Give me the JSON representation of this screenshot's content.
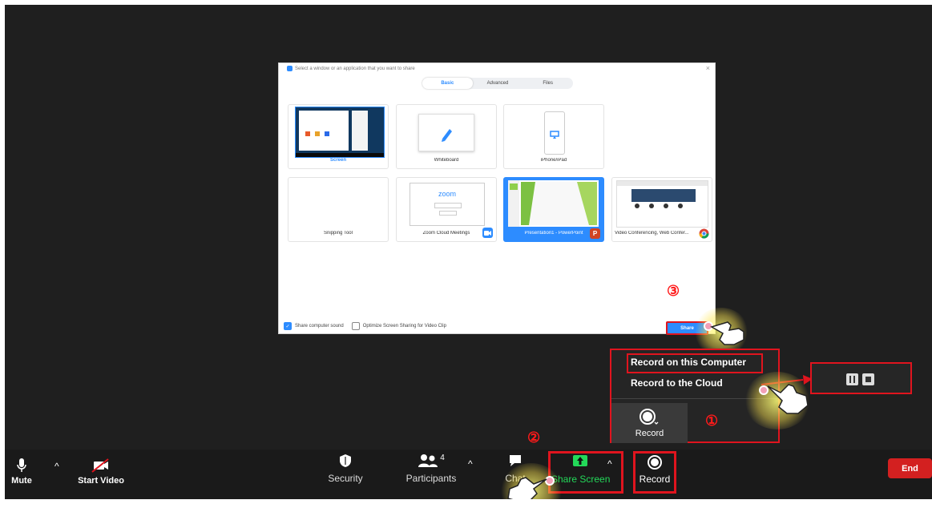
{
  "dialog": {
    "title": "Select a window or an application that you want to share",
    "close_glyph": "×",
    "tabs": [
      "Basic",
      "Advanced",
      "Files"
    ],
    "tiles": [
      {
        "label": "Screen"
      },
      {
        "label": "Whiteboard"
      },
      {
        "label": "iPhone/iPad"
      },
      {
        "label": "Snipping Tool"
      },
      {
        "label": "Zoom Cloud Meetings"
      },
      {
        "label": "Presentation1 - PowerPoint"
      },
      {
        "label": "Video Conferencing, Web Confer..."
      }
    ],
    "share_sound_label": "Share computer sound",
    "optimize_label": "Optimize Screen Sharing for Video Clip",
    "share_button": "Share",
    "zoom_thumb_text": "zoom"
  },
  "record_menu": {
    "item_computer": "Record on this Computer",
    "item_cloud": "Record to the Cloud",
    "record_label": "Record"
  },
  "steps": {
    "one": "①",
    "two": "②",
    "three": "③"
  },
  "toolbar": {
    "mute": "Mute",
    "start_video": "Start Video",
    "security": "Security",
    "participants": "Participants",
    "participants_count": "4",
    "chat": "Chat",
    "share_screen": "Share Screen",
    "record": "Record",
    "end": "End"
  },
  "colors": {
    "accent": "#2d8cff",
    "highlight": "#e0141e",
    "share_green": "#23d959"
  }
}
